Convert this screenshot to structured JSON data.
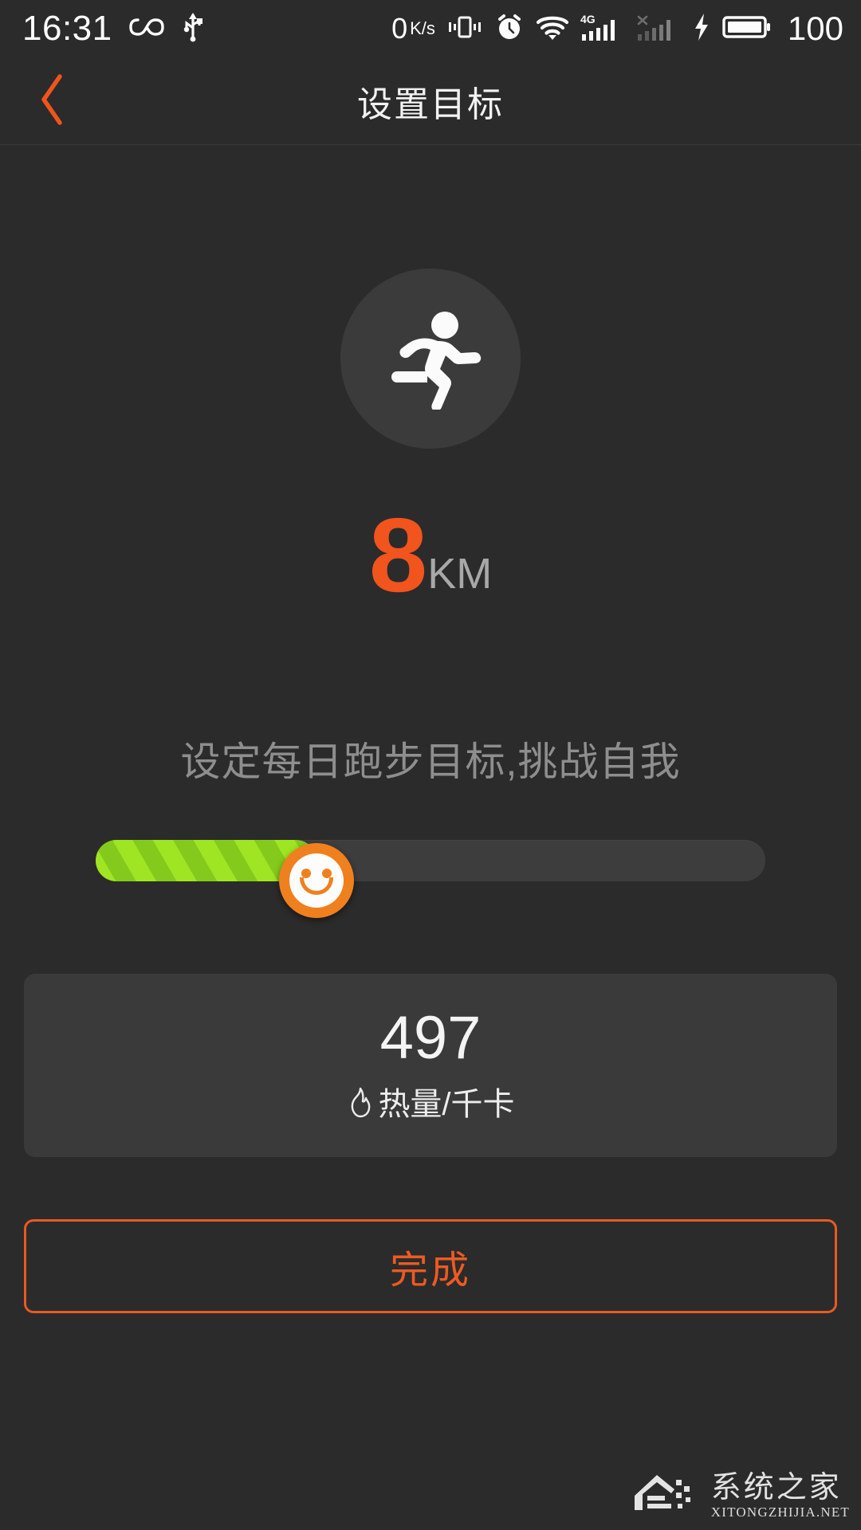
{
  "statusbar": {
    "clock": "16:31",
    "network_speed_value": "0",
    "network_speed_unit": "K/s",
    "battery_percent": "100",
    "icons": [
      "infinity-icon",
      "usb-icon",
      "vibrate-icon",
      "alarm-icon",
      "wifi-icon",
      "signal-4g-icon",
      "signal-no-service-icon",
      "charging-bolt-icon",
      "battery-icon"
    ],
    "network_type": "4G"
  },
  "header": {
    "title": "设置目标",
    "back_icon": "chevron-left-icon",
    "accent_color": "#f1541d"
  },
  "goal": {
    "icon": "running-person-icon",
    "value": "8",
    "unit": "KM",
    "value_color": "#f1541d",
    "unit_color": "#a8a8a8",
    "subtitle": "设定每日跑步目标,挑战自我"
  },
  "slider": {
    "min": 0,
    "max": 20,
    "value": 8,
    "fill_percent": 33,
    "thumb_icon": "smiley-face-icon",
    "fill_color": "#9fe523",
    "fill_stripe_color": "#84ca1c",
    "track_color": "#3d3d3d",
    "thumb_color": "#f0801e"
  },
  "calorie_card": {
    "value": "497",
    "icon": "flame-icon",
    "label": "热量/千卡"
  },
  "done_button": {
    "label": "完成",
    "border_color": "#e85a23",
    "text_color": "#ed5a22"
  },
  "watermark": {
    "logo_icon": "house-logo-icon",
    "cn_text": "系统之家",
    "en_text": "XITONGZHIJIA.NET"
  }
}
